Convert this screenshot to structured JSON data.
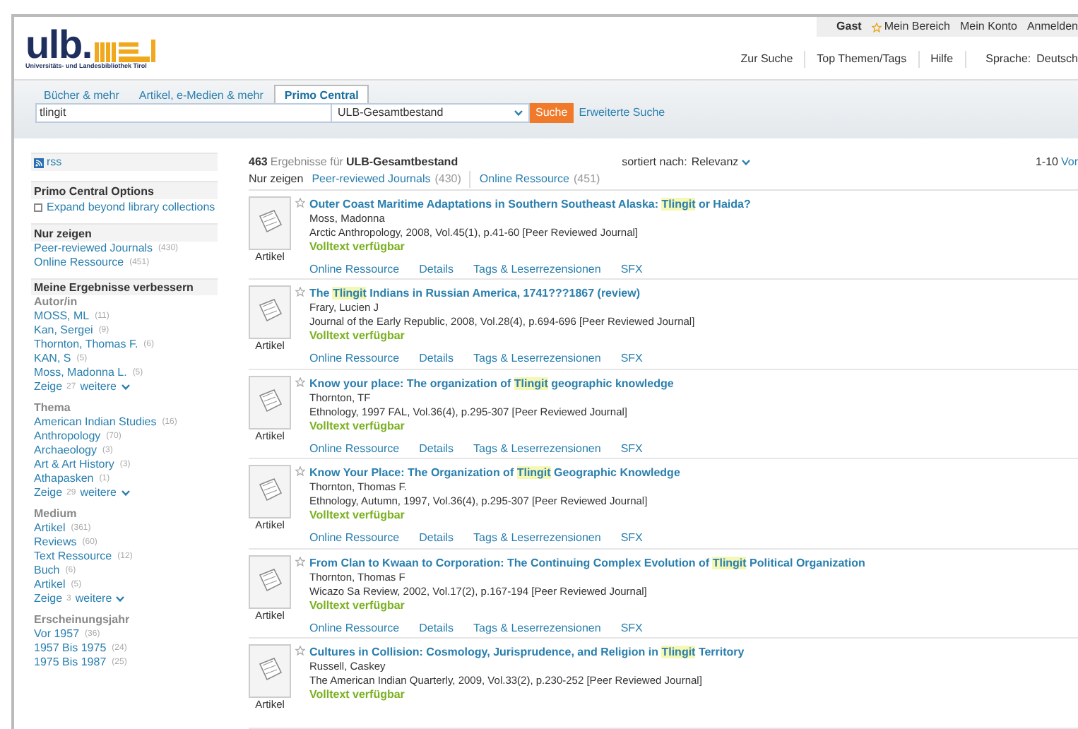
{
  "header": {
    "logo": "ulb.",
    "logo_subtitle": "Universitäts- und Landesbibliothek Tirol",
    "user": "Gast",
    "user_links": [
      "Mein Bereich",
      "Mein Konto",
      "Anmelden"
    ],
    "nav": [
      "Zur Suche",
      "Top Themen/Tags",
      "Hilfe"
    ],
    "language_label": "Sprache:",
    "language": "Deutsch"
  },
  "tabs": [
    {
      "label": "Bücher & mehr",
      "selected": false
    },
    {
      "label": "Artikel, e-Medien & mehr",
      "selected": false
    },
    {
      "label": "Primo Central",
      "selected": true
    }
  ],
  "search": {
    "value": "tlingit",
    "scope": "ULB-Gesamtbestand",
    "button": "Suche",
    "advanced": "Erweiterte Suche"
  },
  "sidebar": {
    "rss": "rss",
    "options": {
      "title": "Primo Central Options",
      "checkbox": {
        "label": "Expand beyond library collections",
        "checked": false
      }
    },
    "show_only": {
      "title": "Nur zeigen",
      "items": [
        {
          "label": "Peer-reviewed Journals",
          "count": "(430)"
        },
        {
          "label": "Online Ressource",
          "count": "(451)"
        }
      ]
    },
    "refine": {
      "title": "Meine Ergebnisse verbessern",
      "groups": [
        {
          "title": "Autor/in",
          "items": [
            {
              "label": "MOSS, ML",
              "count": "(11)"
            },
            {
              "label": "Kan, Sergei",
              "count": "(9)"
            },
            {
              "label": "Thornton, Thomas F.",
              "count": "(6)"
            },
            {
              "label": "KAN, S",
              "count": "(5)"
            },
            {
              "label": "Moss, Madonna L.",
              "count": "(5)"
            }
          ],
          "more": {
            "prefix": "Zeige",
            "count": "27",
            "label": "weitere"
          }
        },
        {
          "title": "Thema",
          "items": [
            {
              "label": "American Indian Studies",
              "count": "(16)"
            },
            {
              "label": "Anthropology",
              "count": "(70)"
            },
            {
              "label": "Archaeology",
              "count": "(3)"
            },
            {
              "label": "Art & Art History",
              "count": "(3)"
            },
            {
              "label": "Athapasken",
              "count": "(1)"
            }
          ],
          "more": {
            "prefix": "Zeige",
            "count": "29",
            "label": "weitere"
          }
        },
        {
          "title": "Medium",
          "items": [
            {
              "label": "Artikel",
              "count": "(361)"
            },
            {
              "label": "Reviews",
              "count": "(60)"
            },
            {
              "label": "Text Ressource",
              "count": "(12)"
            },
            {
              "label": "Buch",
              "count": "(6)"
            },
            {
              "label": "Artikel",
              "count": "(5)"
            }
          ],
          "more": {
            "prefix": "Zeige",
            "count": "3",
            "label": "weitere"
          }
        },
        {
          "title": "Erscheinungsjahr",
          "items": [
            {
              "label": "Vor 1957",
              "count": "(36)"
            },
            {
              "label": "1957 Bis 1975",
              "count": "(24)"
            },
            {
              "label": "1975 Bis 1987",
              "count": "(25)"
            }
          ]
        }
      ]
    }
  },
  "results": {
    "count": "463",
    "count_label": "Ergebnisse für",
    "scope": "ULB-Gesamtbestand",
    "sort_label": "sortiert nach:",
    "sort": "Relevanz",
    "range": "1-10",
    "next": "Vor",
    "filter_label": "Nur zeigen",
    "filters": [
      {
        "label": "Peer-reviewed Journals",
        "count": "(430)"
      },
      {
        "label": "Online Ressource",
        "count": "(451)"
      }
    ],
    "items": [
      {
        "type": "Artikel",
        "title": [
          {
            "text": "Outer Coast Maritime Adaptations in Southern Southeast Alaska: ",
            "highlight": false
          },
          {
            "text": "Tlingit",
            "highlight": true
          },
          {
            "text": " or Haida?",
            "highlight": false
          }
        ],
        "author": "Moss, Madonna",
        "source": "Arctic Anthropology, 2008, Vol.45(1), p.41-60 [Peer Reviewed Journal]",
        "availability": "Volltext verfügbar",
        "links": [
          "Online Ressource",
          "Details",
          "Tags & Leserrezensionen",
          "SFX"
        ]
      },
      {
        "type": "Artikel",
        "title": [
          {
            "text": "The ",
            "highlight": false
          },
          {
            "text": "Tlingit",
            "highlight": true
          },
          {
            "text": " Indians in Russian America, 1741???1867 (review)",
            "highlight": false
          }
        ],
        "author": "Frary, Lucien J",
        "source": "Journal of the Early Republic, 2008, Vol.28(4), p.694-696 [Peer Reviewed Journal]",
        "availability": "Volltext verfügbar",
        "links": [
          "Online Ressource",
          "Details",
          "Tags & Leserrezensionen",
          "SFX"
        ]
      },
      {
        "type": "Artikel",
        "title": [
          {
            "text": "Know your place: The organization of ",
            "highlight": false
          },
          {
            "text": "Tlingit",
            "highlight": true
          },
          {
            "text": " geographic knowledge",
            "highlight": false
          }
        ],
        "author": "Thornton, TF",
        "source": "Ethnology, 1997 FAL, Vol.36(4), p.295-307 [Peer Reviewed Journal]",
        "availability": "Volltext verfügbar",
        "links": [
          "Online Ressource",
          "Details",
          "Tags & Leserrezensionen",
          "SFX"
        ]
      },
      {
        "type": "Artikel",
        "title": [
          {
            "text": "Know Your Place: The Organization of ",
            "highlight": false
          },
          {
            "text": "Tlingit",
            "highlight": true
          },
          {
            "text": " Geographic Knowledge",
            "highlight": false
          }
        ],
        "author": "Thornton, Thomas F.",
        "source": "Ethnology, Autumn, 1997, Vol.36(4), p.295-307 [Peer Reviewed Journal]",
        "availability": "Volltext verfügbar",
        "links": [
          "Online Ressource",
          "Details",
          "Tags & Leserrezensionen",
          "SFX"
        ]
      },
      {
        "type": "Artikel",
        "title": [
          {
            "text": "From Clan to Kwaan to Corporation: The Continuing Complex Evolution of ",
            "highlight": false
          },
          {
            "text": "Tlingit",
            "highlight": true
          },
          {
            "text": " Political Organization",
            "highlight": false
          }
        ],
        "author": "Thornton, Thomas F",
        "source": "Wicazo Sa Review, 2002, Vol.17(2), p.167-194 [Peer Reviewed Journal]",
        "availability": "Volltext verfügbar",
        "links": [
          "Online Ressource",
          "Details",
          "Tags & Leserrezensionen",
          "SFX"
        ]
      },
      {
        "type": "Artikel",
        "title": [
          {
            "text": "Cultures in Collision: Cosmology, Jurisprudence, and Religion in ",
            "highlight": false
          },
          {
            "text": "Tlingit",
            "highlight": true
          },
          {
            "text": " Territory",
            "highlight": false
          }
        ],
        "author": "Russell, Caskey",
        "source": "The American Indian Quarterly, 2009, Vol.33(2), p.230-252 [Peer Reviewed Journal]",
        "availability": "Volltext verfügbar"
      }
    ]
  }
}
